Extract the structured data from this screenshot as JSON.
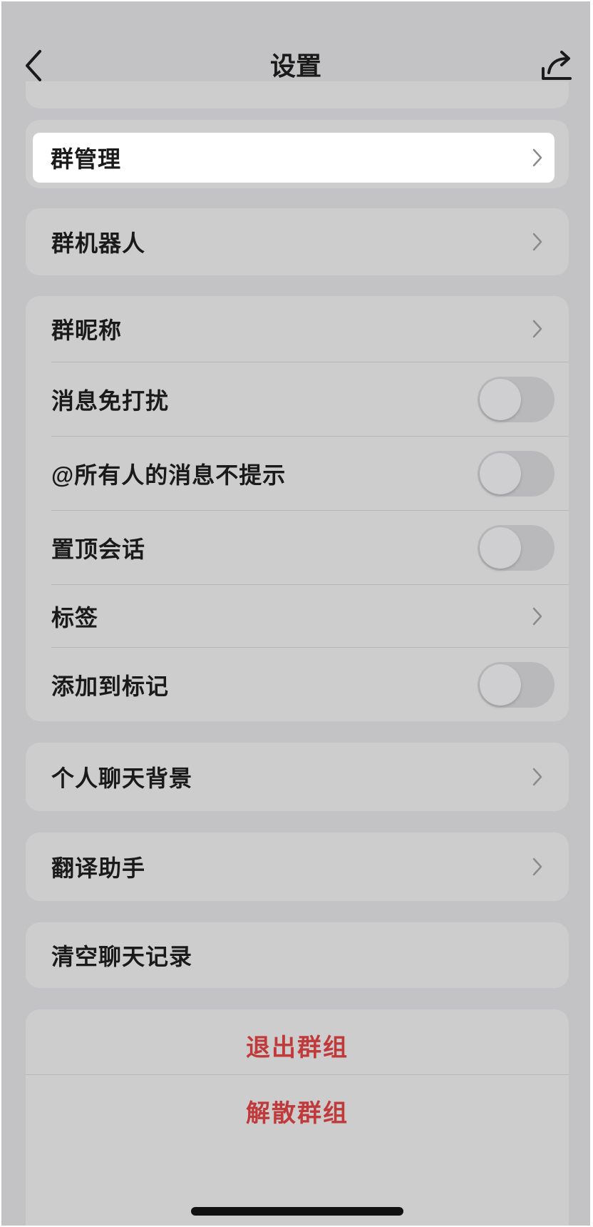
{
  "header": {
    "title": "设置",
    "back_icon": "chevron-left-icon",
    "share_icon": "share-icon"
  },
  "group_manage": {
    "label": "群管理"
  },
  "group_bot": {
    "label": "群机器人"
  },
  "settings": {
    "nickname": "群昵称",
    "mute": {
      "label": "消息免打扰",
      "on": false
    },
    "at_all_mute": {
      "label": "@所有人的消息不提示",
      "on": false
    },
    "pin": {
      "label": "置顶会话",
      "on": false
    },
    "tags": "标签",
    "mark": {
      "label": "添加到标记",
      "on": false
    }
  },
  "chat_background": {
    "label": "个人聊天背景"
  },
  "translate": {
    "label": "翻译助手"
  },
  "clear_history": {
    "label": "清空聊天记录"
  },
  "danger": {
    "leave": "退出群组",
    "dissolve": "解散群组"
  },
  "colors": {
    "danger": "#c0393b",
    "background": "#c3c3c5",
    "card": "#cdcdcd"
  }
}
